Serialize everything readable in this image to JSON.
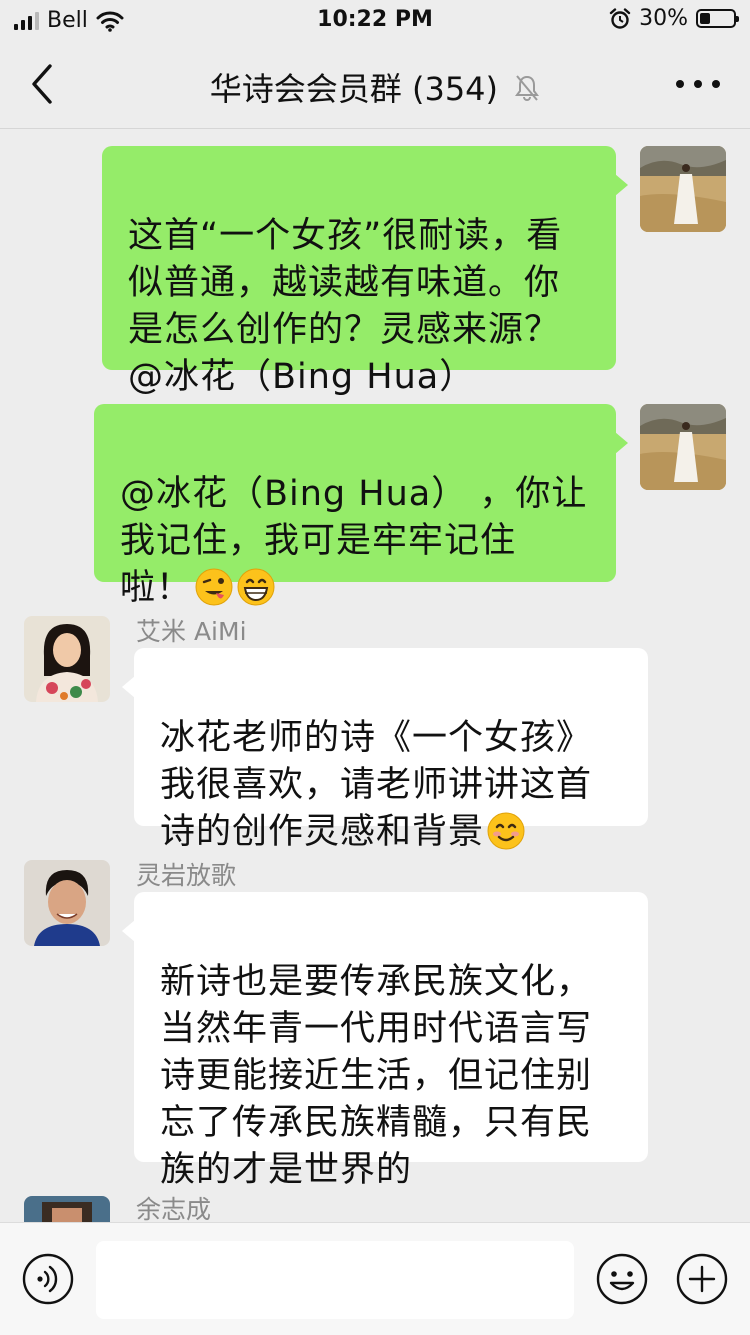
{
  "status_bar": {
    "carrier": "Bell",
    "time": "10:22 PM",
    "battery_percent": "30%",
    "battery_level": 0.3
  },
  "nav": {
    "title": "华诗会会员群 (354)"
  },
  "messages": [
    {
      "direction": "out",
      "text": "这首“一个女孩”很耐读，看\n似普通，越读越有味道。你\n是怎么创作的？灵感来源？\n@冰花（Bing Hua）",
      "avatar_icon": "woman-in-white-dress-avatar"
    },
    {
      "direction": "out",
      "text": "@冰花（Bing Hua） ，你让\n我记住，我可是牢牢记住\n啦！",
      "emojis": [
        "winking-tongue-emoji",
        "grinning-emoji"
      ],
      "avatar_icon": "woman-in-white-dress-avatar"
    },
    {
      "direction": "in",
      "sender": "艾米 AiMi",
      "text": "冰花老师的诗《一个女孩》\n我很喜欢，请老师讲讲这首\n诗的创作灵感和背景",
      "emojis": [
        "smiling-blush-emoji"
      ],
      "avatar_icon": "woman-floral-avatar"
    },
    {
      "direction": "in",
      "sender": "灵岩放歌",
      "text": "新诗也是要传承民族文化，\n当然年青一代用时代语言写\n诗更能接近生活，但记住别\n忘了传承民族精髓，只有民\n族的才是世界的",
      "avatar_icon": "man-portrait-avatar"
    },
    {
      "direction": "in",
      "sender": "余志成",
      "avatar_icon": "man-partial-avatar"
    }
  ],
  "input_bar": {
    "text_value": ""
  },
  "colors": {
    "background": "#ededed",
    "outgoing_bubble": "#95ec69",
    "incoming_bubble": "#ffffff",
    "sender_name": "#8a8a8a"
  }
}
